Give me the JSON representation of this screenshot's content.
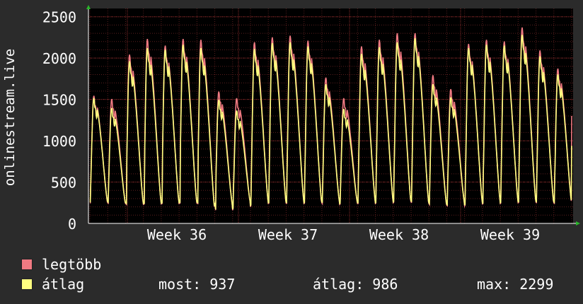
{
  "chart_data": {
    "type": "line",
    "ylabel": "onlinestream.live",
    "ylim": [
      0,
      2600
    ],
    "yticks": [
      0,
      500,
      1000,
      1500,
      2000,
      2500
    ],
    "x_tick_labels": [
      "Week 36",
      "Week 37",
      "Week 38",
      "Week 39"
    ],
    "grid": true,
    "background": "#000000",
    "colors": {
      "legtobb": "#f07a82",
      "atlag": "#ffff80",
      "grid": "#5a1e1e",
      "axis": "#ffffff"
    },
    "series": [
      {
        "name": "legtöbb",
        "daily_peaks": [
          1540,
          1500,
          2040,
          2230,
          2150,
          2230,
          2220,
          1590,
          1510,
          2190,
          2250,
          2270,
          2210,
          1760,
          1510,
          2140,
          2220,
          2300,
          2300,
          1790,
          1620,
          2170,
          2220,
          2200,
          2370,
          2090,
          1870
        ],
        "last_value": 1300
      },
      {
        "name": "átlag",
        "daily_peaks": [
          1510,
          1390,
          1960,
          2120,
          2100,
          2160,
          2120,
          1490,
          1360,
          2110,
          2180,
          2190,
          2140,
          1680,
          1380,
          2050,
          2130,
          2190,
          2240,
          1680,
          1520,
          2120,
          2160,
          2150,
          2280,
          2020,
          1800
        ],
        "last_value": 937
      }
    ],
    "daily_lows": [
      250,
      240,
      230,
      235,
      240,
      245,
      240,
      160,
      200,
      240,
      245,
      240,
      250,
      230,
      240,
      240,
      250,
      260,
      240,
      220,
      210,
      235,
      240,
      250,
      255,
      250,
      240
    ]
  },
  "legend": [
    {
      "label": "legtöbb",
      "color": "#f07a82"
    },
    {
      "label": "átlag",
      "color": "#ffff80"
    }
  ],
  "stats": {
    "most": "most: 937",
    "atlag": "átlag: 986",
    "max": "max: 2299"
  }
}
